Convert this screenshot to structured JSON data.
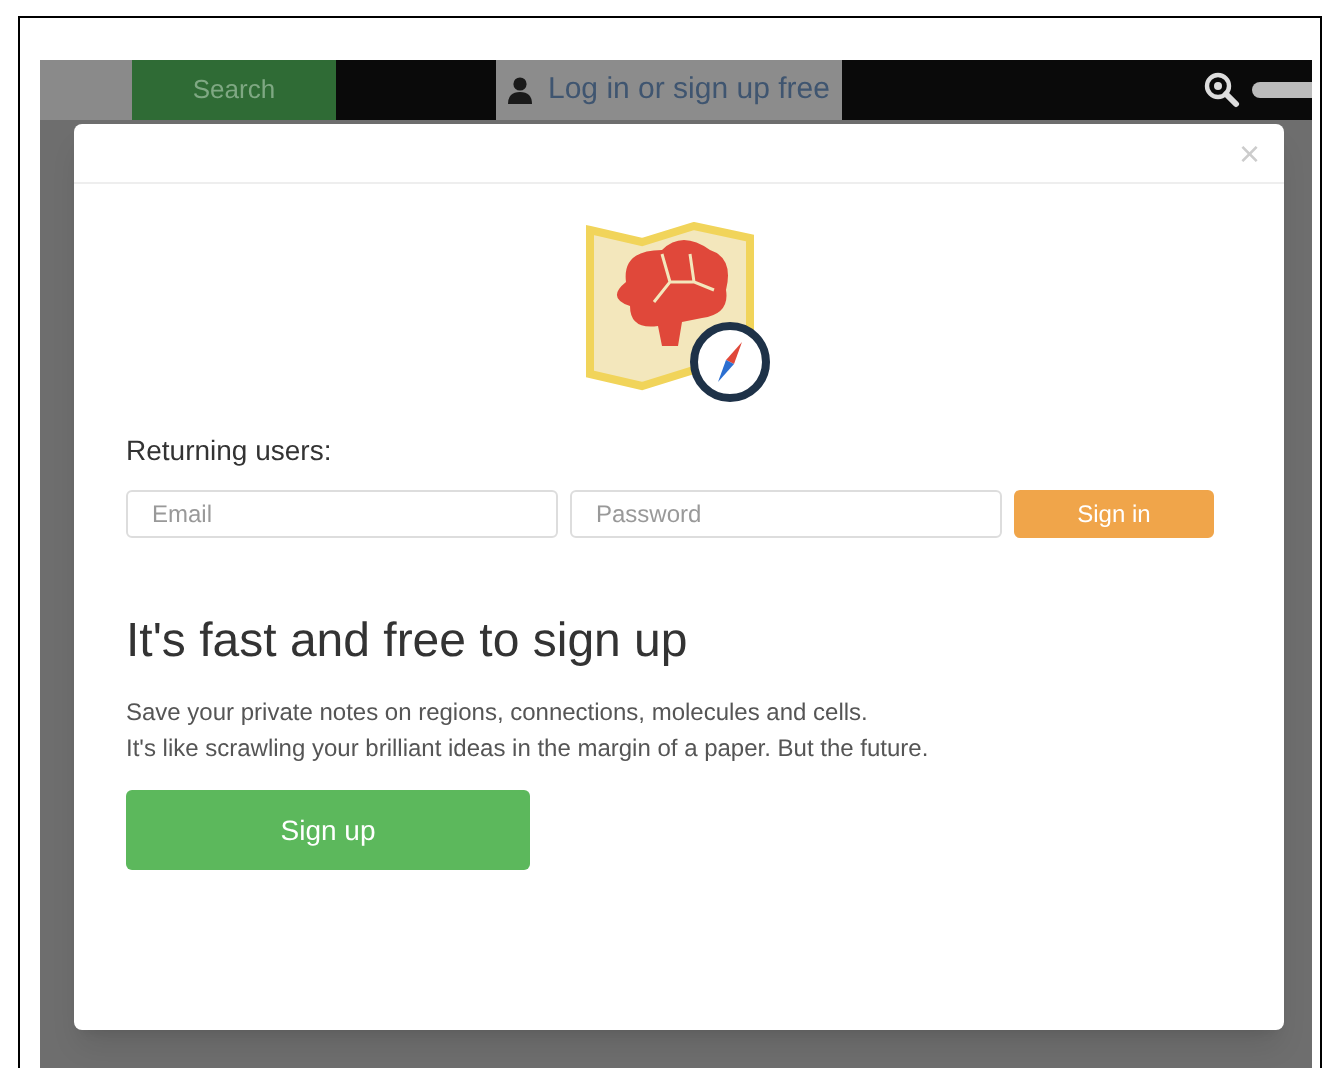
{
  "top_bar": {
    "search_button": "Search",
    "login_link": "Log in or sign up free"
  },
  "modal": {
    "close": "×",
    "returning_label": "Returning users:",
    "email": {
      "placeholder": "Email"
    },
    "password": {
      "placeholder": "Password"
    },
    "sign_in_button": "Sign in",
    "heading": "It's fast and free to sign up",
    "description": [
      "Save your private notes on regions, connections, molecules and cells.",
      "It's like scrawling your brilliant ideas in the margin of a paper. But the future."
    ],
    "sign_up_button": "Sign up"
  }
}
